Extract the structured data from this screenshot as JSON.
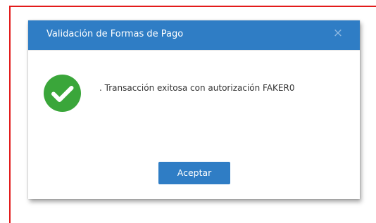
{
  "dialog": {
    "title": "Validación de Formas de Pago",
    "close_symbol": "×",
    "status_icon": "check-circle-icon",
    "message": ". Transacción exitosa con autorización FAKER0",
    "accept_label": "Aceptar"
  },
  "colors": {
    "header": "#2f7dc5",
    "button": "#2f7dc5",
    "success": "#3aa63a",
    "frame_border": "#e21b1b"
  }
}
